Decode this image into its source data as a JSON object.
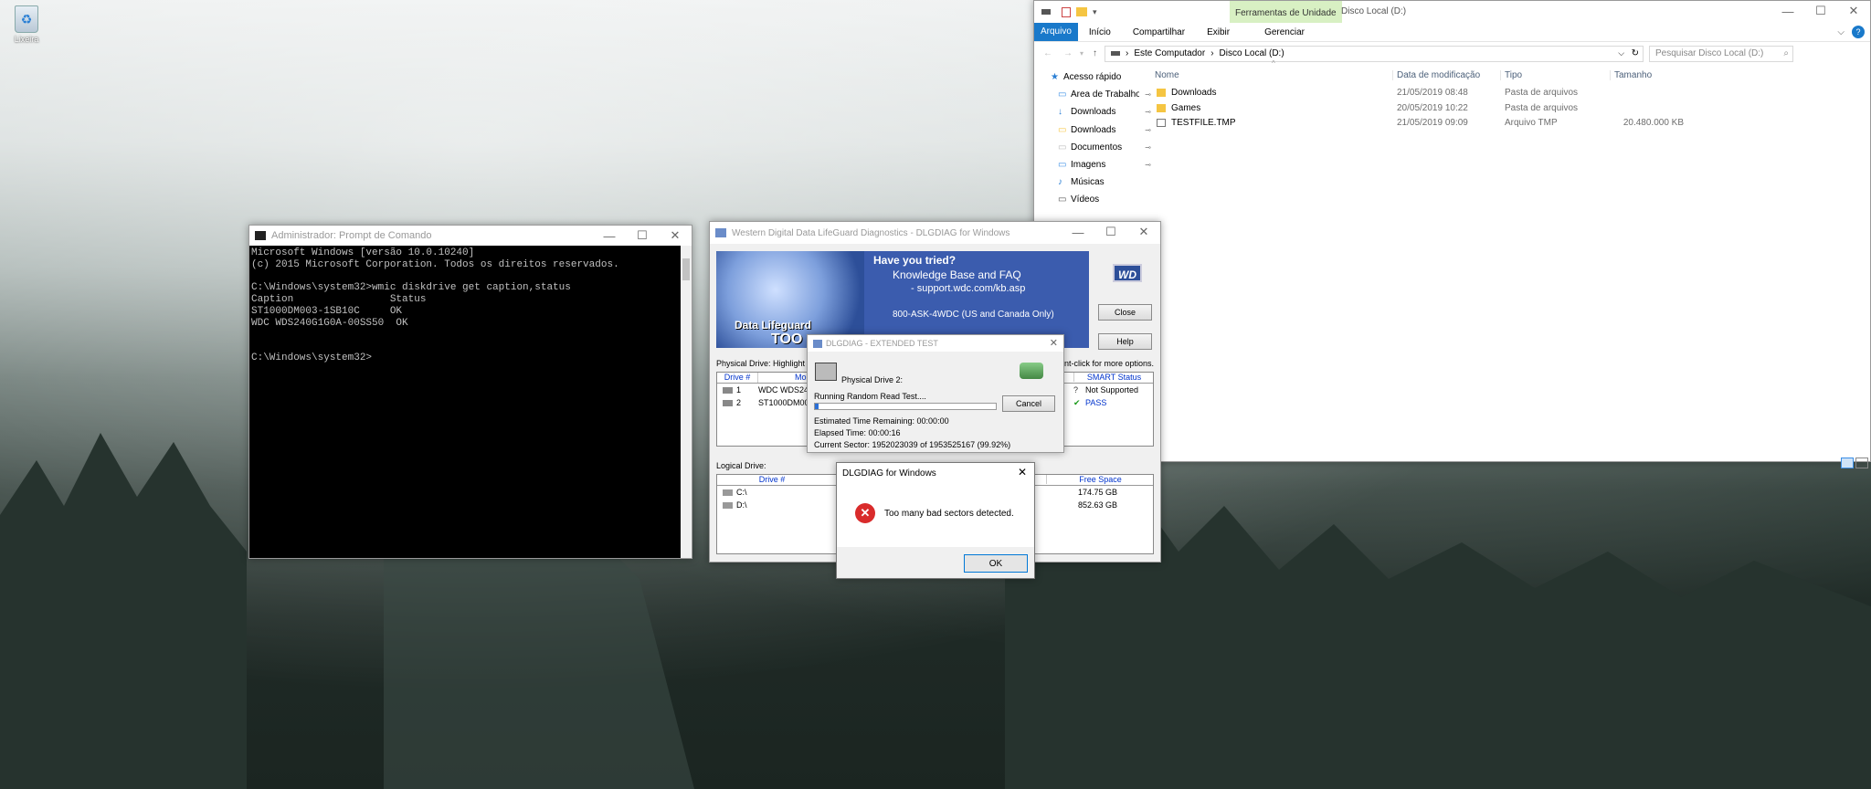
{
  "desktop": {
    "recycle_label": "Lixeira"
  },
  "cmd": {
    "title": "Administrador: Prompt de Comando",
    "lines": [
      "Microsoft Windows [versão 10.0.10240]",
      "(c) 2015 Microsoft Corporation. Todos os direitos reservados.",
      "",
      "C:\\Windows\\system32>wmic diskdrive get caption,status",
      "Caption                Status",
      "ST1000DM003-1SB10C     OK",
      "WDC WDS240G1G0A-00SS50  OK",
      "",
      "",
      "C:\\Windows\\system32>"
    ]
  },
  "explorer": {
    "title": "Disco Local (D:)",
    "context_tab": "Ferramentas de Unidade",
    "ribbon_tabs": [
      "Arquivo",
      "Início",
      "Compartilhar",
      "Exibir",
      "Gerenciar"
    ],
    "breadcrumb": [
      "Este Computador",
      "Disco Local (D:)"
    ],
    "search_placeholder": "Pesquisar Disco Local (D:)",
    "nav": [
      "Acesso rápido",
      "Área de Trabalho",
      "Downloads",
      "Downloads",
      "Documentos",
      "Imagens",
      "Músicas",
      "Vídeos"
    ],
    "columns": [
      "Nome",
      "Data de modificação",
      "Tipo",
      "Tamanho"
    ],
    "files": [
      {
        "name": "Downloads",
        "date": "21/05/2019 08:48",
        "type": "Pasta de arquivos",
        "size": ""
      },
      {
        "name": "Games",
        "date": "20/05/2019 10:22",
        "type": "Pasta de arquivos",
        "size": ""
      },
      {
        "name": "TESTFILE.TMP",
        "date": "21/05/2019 09:09",
        "type": "Arquivo TMP",
        "size": "20.480.000 KB"
      }
    ]
  },
  "wd": {
    "title": "Western Digital Data LifeGuard Diagnostics - DLGDIAG for Windows",
    "banner": {
      "headline": "Have you tried?",
      "kb": "Knowledge Base and FAQ",
      "url": "- support.wdc.com/kb.asp",
      "phone": "800-ASK-4WDC (US and Canada Only)",
      "brand": "Data Lifeguard",
      "brand2": "TOO",
      "logo": "WD"
    },
    "close": "Close",
    "help": "Help",
    "phys_label": "Physical Drive:",
    "phys_hint": "Highlight",
    "phys_hint2": "nt-click for more options.",
    "phys_cols": [
      "Drive #",
      "Mo",
      "SMART Status"
    ],
    "phys_rows": [
      {
        "num": "1",
        "model": "WDC WDS24",
        "smart": "Not Supported"
      },
      {
        "num": "2",
        "model": "ST1000DM00",
        "smart": "PASS"
      }
    ],
    "log_label": "Logical Drive:",
    "log_cols": [
      "Drive #",
      "Free Space"
    ],
    "log_rows": [
      {
        "drive": "C:\\",
        "free": "174.75 GB"
      },
      {
        "drive": "D:\\",
        "free": "852.63 GB"
      }
    ]
  },
  "ext": {
    "title": "DLGDIAG - EXTENDED TEST",
    "drive": "Physical Drive 2:",
    "status": "Running Random Read Test....",
    "cancel": "Cancel",
    "progress": 0.02,
    "remaining": "Estimated Time Remaining: 00:00:00",
    "elapsed": "Elapsed Time: 00:00:16",
    "sector": "Current Sector: 1952023039 of 1953525167 (99.92%)"
  },
  "msg": {
    "title": "DLGDIAG for Windows",
    "text": "Too many bad sectors detected.",
    "ok": "OK"
  }
}
